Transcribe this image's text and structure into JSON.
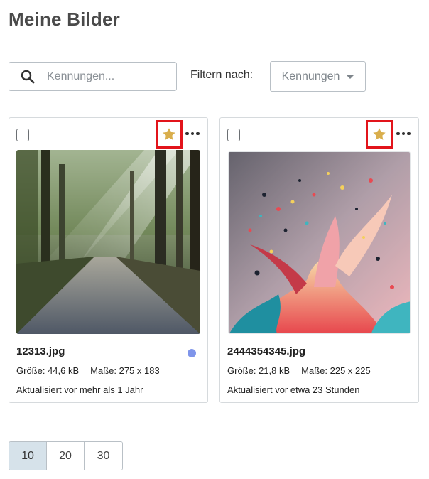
{
  "page": {
    "title": "Meine Bilder"
  },
  "toolbar": {
    "search_placeholder": "Kennungen...",
    "search_icon": "search-icon",
    "filter_label": "Filtern nach:",
    "filter_value": "Kennungen"
  },
  "cards": [
    {
      "file_name": "12313.jpg",
      "size_label": "Größe: 44,6 kB",
      "dimensions_label": "Maße: 275 x 183",
      "updated_label": "Aktualisiert vor mehr als 1 Jahr",
      "favorite": true,
      "status_color": "#7f95ea",
      "image": "forest-path-photo"
    },
    {
      "file_name": "2444354345.jpg",
      "size_label": "Größe: 21,8 kB",
      "dimensions_label": "Maße: 225 x 225",
      "updated_label": "Aktualisiert vor etwa 23 Stunden",
      "favorite": true,
      "image": "paint-splash-photo"
    }
  ],
  "pagination": {
    "options": [
      "10",
      "20",
      "30"
    ],
    "selected": "10"
  },
  "colors": {
    "star": "#d9ae4c",
    "highlight_border": "#e2141b",
    "pagination_active": "#d6e2ea"
  }
}
